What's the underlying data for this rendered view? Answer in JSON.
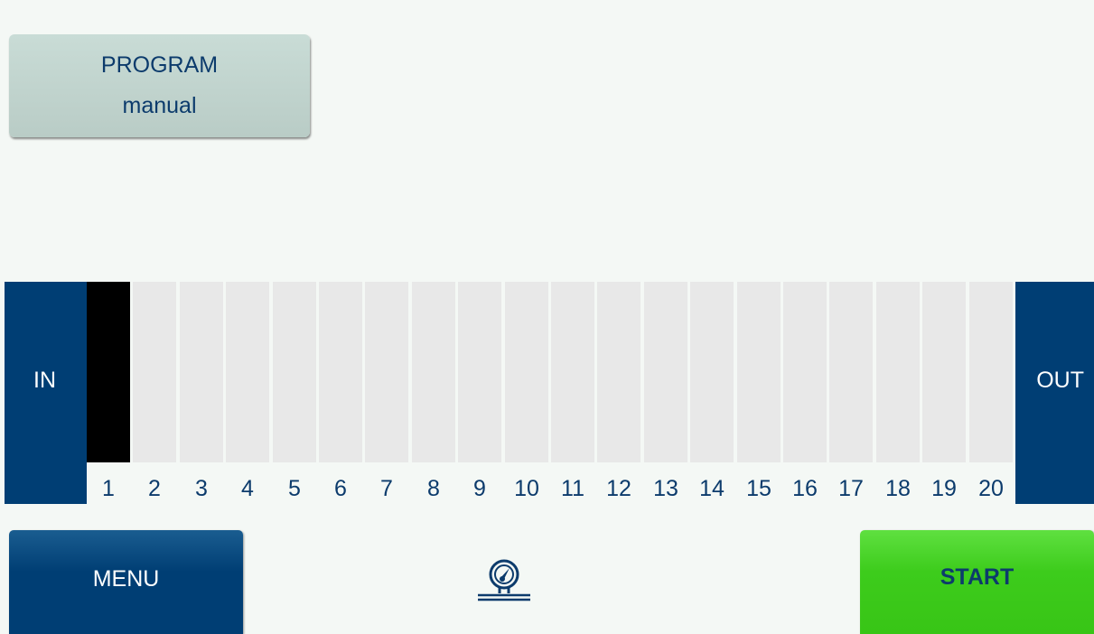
{
  "program": {
    "title": "PROGRAM",
    "value": "manual"
  },
  "lane": {
    "in_label": "IN",
    "out_label": "OUT",
    "slots": [
      "1",
      "2",
      "3",
      "4",
      "5",
      "6",
      "7",
      "8",
      "9",
      "10",
      "11",
      "12",
      "13",
      "14",
      "15",
      "16",
      "17",
      "18",
      "19",
      "20"
    ],
    "active_slot": "1"
  },
  "buttons": {
    "menu_label": "MENU",
    "start_label": "START"
  },
  "icons": {
    "status": "pressure-gauge-icon"
  },
  "colors": {
    "navy": "#003e74",
    "text_blue": "#0c3b6c",
    "start_green": "#3dcc1c",
    "program_bg": "#c3d6d0",
    "slot_empty": "#e8e8e8",
    "slot_active": "#000000"
  }
}
